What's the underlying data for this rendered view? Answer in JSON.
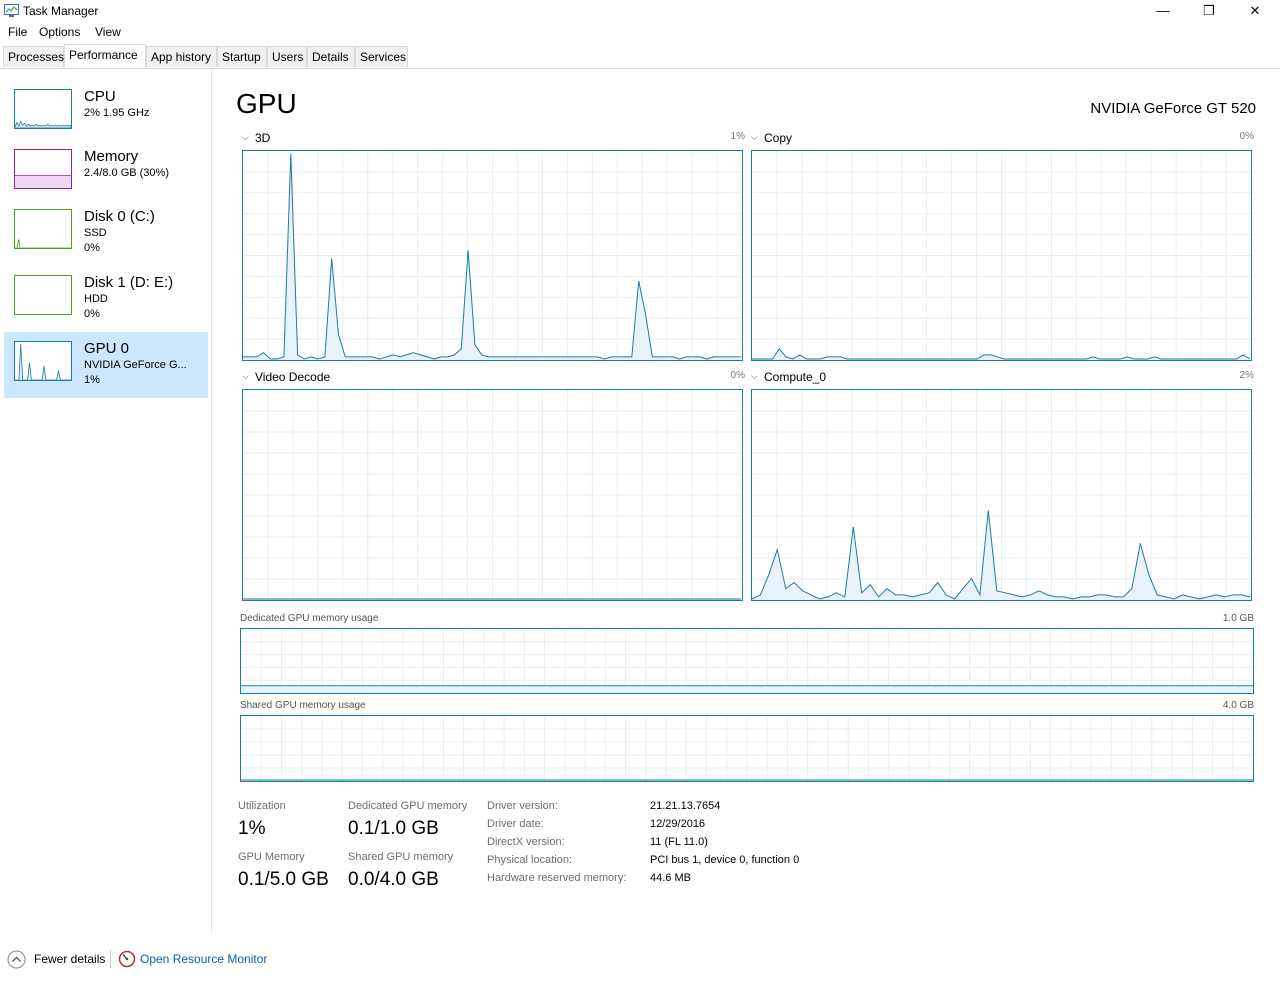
{
  "window": {
    "title": "Task Manager",
    "minimize_glyph": "—",
    "restore_glyph": "❐",
    "close_glyph": "✕"
  },
  "menu": {
    "file": "File",
    "options": "Options",
    "view": "View"
  },
  "tabs": [
    "Processes",
    "Performance",
    "App history",
    "Startup",
    "Users",
    "Details",
    "Services"
  ],
  "sidebar": {
    "items": [
      {
        "title": "CPU",
        "line1": "2%  1.95 GHz",
        "line2": "",
        "color": "#1d7ba7"
      },
      {
        "title": "Memory",
        "line1": "2.4/8.0 GB (30%)",
        "line2": "",
        "color": "#8b1fa9"
      },
      {
        "title": "Disk 0 (C:)",
        "line1": "SSD",
        "line2": "0%",
        "color": "#4da01d"
      },
      {
        "title": "Disk 1 (D: E:)",
        "line1": "HDD",
        "line2": "0%",
        "color": "#4da01d"
      },
      {
        "title": "GPU 0",
        "line1": "NVIDIA GeForce G...",
        "line2": "1%",
        "color": "#1d7ba7"
      }
    ]
  },
  "main": {
    "title": "GPU",
    "model": "NVIDIA GeForce GT 520",
    "engines": [
      {
        "name": "3D",
        "percent": "1%"
      },
      {
        "name": "Copy",
        "percent": "0%"
      },
      {
        "name": "Video Decode",
        "percent": "0%"
      },
      {
        "name": "Compute_0",
        "percent": "2%"
      }
    ],
    "dedicated_label": "Dedicated GPU memory usage",
    "dedicated_max": "1.0 GB",
    "shared_label": "Shared GPU memory usage",
    "shared_max": "4.0 GB"
  },
  "stats": {
    "utilization_label": "Utilization",
    "utilization_value": "1%",
    "dedicated_label": "Dedicated GPU memory",
    "dedicated_value": "0.1/1.0 GB",
    "gpu_memory_label": "GPU Memory",
    "gpu_memory_value": "0.1/5.0 GB",
    "shared_label": "Shared GPU memory",
    "shared_value": "0.0/4.0 GB"
  },
  "info": {
    "driver_version_label": "Driver version:",
    "driver_version": "21.21.13.7654",
    "driver_date_label": "Driver date:",
    "driver_date": "12/29/2016",
    "directx_label": "DirectX version:",
    "directx": "11 (FL 11.0)",
    "location_label": "Physical location:",
    "location": "PCI bus 1, device 0, function 0",
    "reserved_label": "Hardware reserved memory:",
    "reserved": "44.6 MB"
  },
  "footer": {
    "fewer_details": "Fewer details",
    "resource_monitor": "Open Resource Monitor"
  },
  "colors": {
    "accent": "#1d7ba7",
    "selected": "#cce8ff",
    "link": "#0b5fae"
  },
  "graph_series": {
    "engine_3d": [
      0.01,
      0.01,
      0.01,
      0.03,
      0.0,
      0.0,
      0.01,
      1.0,
      0.02,
      0.0,
      0.01,
      0.0,
      0.01,
      0.49,
      0.12,
      0.01,
      0.01,
      0.01,
      0.01,
      0.01,
      0.0,
      0.01,
      0.02,
      0.01,
      0.02,
      0.03,
      0.02,
      0.01,
      0.0,
      0.01,
      0.01,
      0.02,
      0.05,
      0.53,
      0.07,
      0.02,
      0.01,
      0.01,
      0.01,
      0.01,
      0.01,
      0.01,
      0.01,
      0.01,
      0.01,
      0.01,
      0.01,
      0.01,
      0.01,
      0.01,
      0.01,
      0.01,
      0.01,
      0.0,
      0.01,
      0.01,
      0.01,
      0.01,
      0.38,
      0.22,
      0.01,
      0.01,
      0.01,
      0.01,
      0.0,
      0.01,
      0.01,
      0.01,
      0.0,
      0.01,
      0.01,
      0.01,
      0.01,
      0.01
    ],
    "engine_copy": [
      0.0,
      0.0,
      0.0,
      0.0,
      0.05,
      0.01,
      0.0,
      0.02,
      0.0,
      0.0,
      0.0,
      0.01,
      0.01,
      0.01,
      0.0,
      0.0,
      0.0,
      0.0,
      0.0,
      0.0,
      0.0,
      0.0,
      0.0,
      0.0,
      0.0,
      0.0,
      0.0,
      0.0,
      0.0,
      0.0,
      0.0,
      0.0,
      0.0,
      0.0,
      0.02,
      0.02,
      0.01,
      0.0,
      0.0,
      0.0,
      0.0,
      0.0,
      0.0,
      0.0,
      0.0,
      0.0,
      0.0,
      0.0,
      0.0,
      0.0,
      0.01,
      0.0,
      0.0,
      0.0,
      0.0,
      0.01,
      0.0,
      0.0,
      0.0,
      0.01,
      0.0,
      0.0,
      0.0,
      0.0,
      0.0,
      0.0,
      0.0,
      0.0,
      0.0,
      0.0,
      0.0,
      0.0,
      0.02,
      0.0
    ],
    "engine_video_decode": [
      0,
      0,
      0,
      0,
      0,
      0,
      0,
      0,
      0,
      0,
      0,
      0,
      0,
      0,
      0,
      0,
      0,
      0,
      0,
      0
    ],
    "engine_compute": [
      0.0,
      0.02,
      0.12,
      0.24,
      0.05,
      0.08,
      0.04,
      0.02,
      0.0,
      0.01,
      0.03,
      0.01,
      0.35,
      0.03,
      0.07,
      0.01,
      0.05,
      0.02,
      0.02,
      0.01,
      0.02,
      0.03,
      0.08,
      0.02,
      0.0,
      0.05,
      0.1,
      0.02,
      0.43,
      0.04,
      0.03,
      0.02,
      0.01,
      0.02,
      0.04,
      0.02,
      0.01,
      0.01,
      0.0,
      0.01,
      0.01,
      0.02,
      0.02,
      0.01,
      0.01,
      0.05,
      0.27,
      0.12,
      0.02,
      0.01,
      0.0,
      0.02,
      0.01,
      0.0,
      0.01,
      0.02,
      0.01,
      0.02,
      0.02,
      0.01
    ],
    "dedicated_fraction": 0.1,
    "shared_fraction": 0.0
  }
}
